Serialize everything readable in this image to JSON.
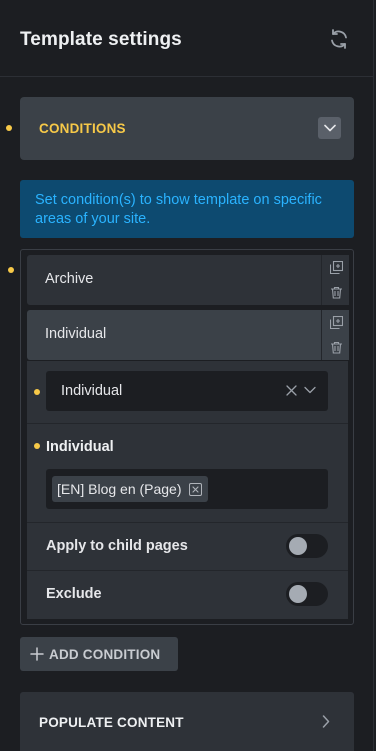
{
  "header": {
    "title": "Template settings",
    "refresh_icon": "refresh-icon"
  },
  "conditions_section": {
    "title": "CONDITIONS",
    "collapse_icon": "chevron-down-icon",
    "info_text": "Set condition(s) to show template on specific areas of your site."
  },
  "conditions": [
    {
      "label": "Archive",
      "expanded": false,
      "actions": [
        "duplicate-icon",
        "trash-icon"
      ]
    },
    {
      "label": "Individual",
      "expanded": true,
      "actions": [
        "duplicate-icon",
        "trash-icon"
      ]
    }
  ],
  "individual_settings": {
    "type_select": {
      "value": "Individual",
      "clear_icon": "close-icon",
      "dropdown_icon": "chevron-down-icon"
    },
    "items_label": "Individual",
    "selected_items": [
      "[EN] Blog en (Page)"
    ],
    "apply_to_child_pages": {
      "label": "Apply to child pages",
      "on": false
    },
    "exclude": {
      "label": "Exclude",
      "on": false
    }
  },
  "add_condition_button": {
    "label": "ADD CONDITION",
    "icon": "plus-icon"
  },
  "populate_section": {
    "title": "POPULATE CONTENT",
    "icon": "chevron-right-icon"
  },
  "colors": {
    "background": "#1c1e22",
    "accent_yellow": "#f7c948",
    "info_bg": "#0d4a70",
    "info_text": "#2ab3ff",
    "row_bg": "#2e3238",
    "row_active_bg": "#3b4148"
  }
}
